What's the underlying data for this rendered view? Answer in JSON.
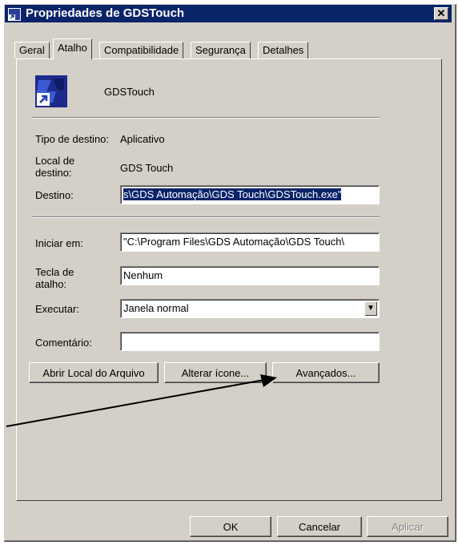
{
  "window": {
    "title": "Propriedades de GDSTouch",
    "close_label": "✕"
  },
  "tabs": [
    {
      "label": "Geral"
    },
    {
      "label": "Atalho",
      "active": true
    },
    {
      "label": "Compatibilidade"
    },
    {
      "label": "Segurança"
    },
    {
      "label": "Detalhes"
    }
  ],
  "shortcut": {
    "name": "GDSTouch",
    "target_type_label": "Tipo de destino:",
    "target_type_value": "Aplicativo",
    "target_location_label": "Local de destino:",
    "target_location_value": "GDS Touch",
    "target_label": "Destino:",
    "target_value": "s\\GDS Automação\\GDS Touch\\GDSTouch.exe\"",
    "start_in_label": "Iniciar em:",
    "start_in_value": "\"C:\\Program Files\\GDS Automação\\GDS Touch\\",
    "hotkey_label": "Tecla de atalho:",
    "hotkey_value": "Nenhum",
    "run_label": "Executar:",
    "run_value": "Janela normal",
    "comment_label": "Comentário:",
    "comment_value": ""
  },
  "buttons": {
    "open_location": "Abrir Local do Arquivo",
    "change_icon": "Alterar ícone...",
    "advanced": "Avançados...",
    "ok": "OK",
    "cancel": "Cancelar",
    "apply": "Aplicar"
  },
  "colors": {
    "titlebar": "#0a246a",
    "face": "#d4d0c8",
    "annotation_arrow": "#000000"
  }
}
